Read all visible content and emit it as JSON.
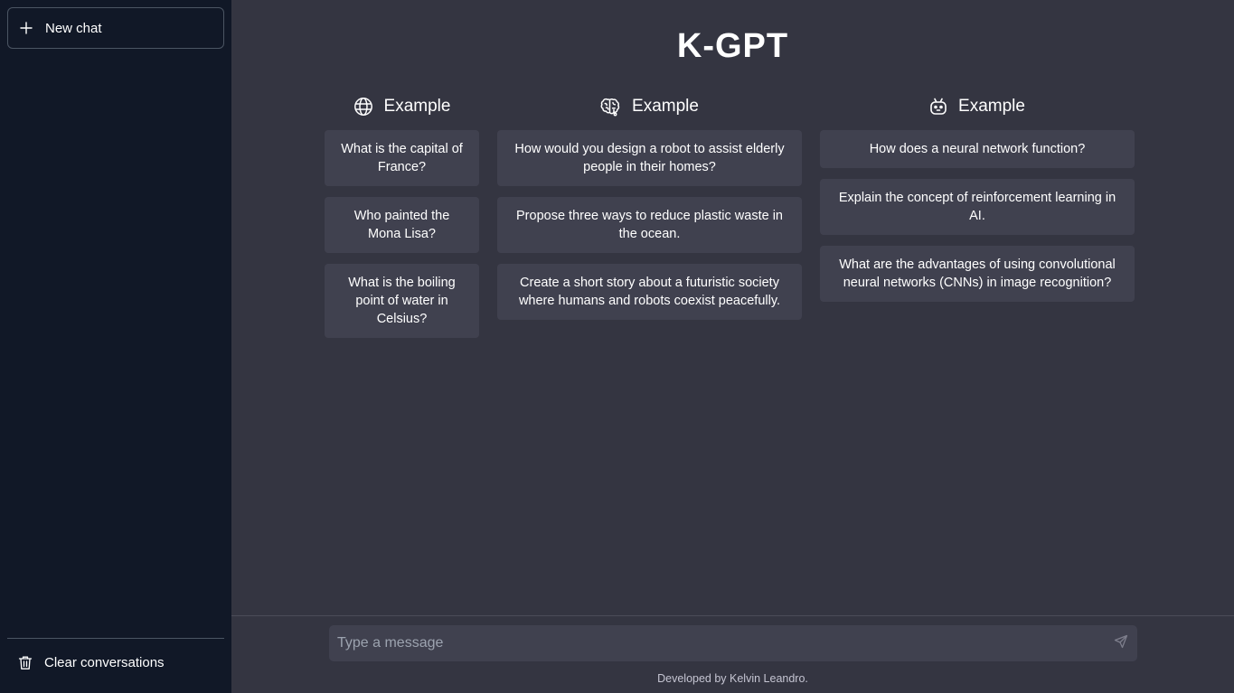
{
  "sidebar": {
    "new_chat_label": "New chat",
    "new_chat_icon": "plus-icon",
    "clear_label": "Clear conversations",
    "clear_icon": "trash-icon"
  },
  "main": {
    "title": "K-GPT",
    "columns": [
      {
        "icon": "globe-icon",
        "heading": "Example",
        "examples": [
          "What is the capital of France?",
          "Who painted the Mona Lisa?",
          "What is the boiling point of water in Celsius?"
        ]
      },
      {
        "icon": "brain-icon",
        "heading": "Example",
        "examples": [
          "How would you design a robot to assist elderly people in their homes?",
          "Propose three ways to reduce plastic waste in the ocean.",
          "Create a short story about a futuristic society where humans and robots coexist peacefully."
        ]
      },
      {
        "icon": "robot-icon",
        "heading": "Example",
        "examples": [
          "How does a neural network function?",
          "Explain the concept of reinforcement learning in AI.",
          "What are the advantages of using convolutional neural networks (CNNs) in image recognition?"
        ]
      }
    ]
  },
  "composer": {
    "placeholder": "Type a message",
    "value": "",
    "send_icon": "send-icon"
  },
  "footer": {
    "text": "Developed by Kelvin Leandro."
  },
  "colors": {
    "sidebar_bg": "#111827",
    "main_bg": "#343541",
    "card_bg": "#40414f"
  }
}
